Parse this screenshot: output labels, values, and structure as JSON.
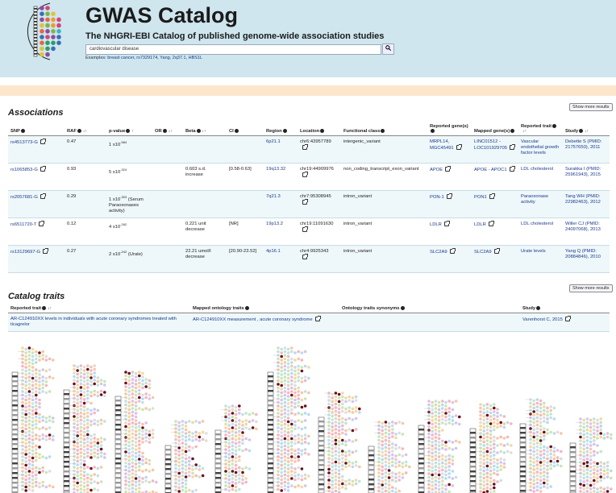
{
  "header": {
    "title": "GWAS Catalog",
    "subtitle": "The NHGRI-EBI Catalog of published genome-wide association studies",
    "search_value": "cardiovascular disease",
    "search_icon": "search-icon",
    "examples_label": "Examples:",
    "examples": [
      "breast cancer,",
      "rs7329174,",
      "Yang,",
      "2q37.1,",
      "HBS1L"
    ]
  },
  "associations": {
    "heading": "Associations",
    "show_more_top": "Show more results",
    "show_more_bottom": "Show more results",
    "columns": [
      "SNP",
      "RAF",
      "p-value",
      "OR",
      "Beta",
      "CI",
      "Region",
      "Location",
      "Functional class",
      "Reported gene(s)",
      "Mapped gene(s)",
      "Reported trait",
      "Study"
    ],
    "rows": [
      {
        "snp": "rs4513773-G",
        "raf": "0.47",
        "p_base": "1 x10",
        "p_exp": "-584",
        "p_note": "",
        "or": "",
        "beta": "",
        "ci": "",
        "region": "6p21.1",
        "location": "chr6:43957789",
        "func": "intergenic_variant",
        "reported": "MRPL14, MGC45491",
        "mapped": "LINC01512 - LOC101929705",
        "trait": "Vascular endothelial growth factor levels",
        "study": "Debette S (PMID: 21757650), 2011"
      },
      {
        "snp": "rs1065853-G",
        "raf": "0.93",
        "p_base": "5 x10",
        "p_exp": "-324",
        "p_note": "",
        "or": "",
        "beta": "0.603 s.d. increase",
        "ci": "[0.58-0.63]",
        "region": "19q13.32",
        "location": "chr19:44909976",
        "func": "non_coding_transcript_exon_variant",
        "reported": "APOE",
        "mapped": "APOE - APOC1",
        "trait": "LDL cholesterol",
        "study": "Surakka I (PMID: 25961943), 2015"
      },
      {
        "snp": "rs2057681-G",
        "raf": "0.29",
        "p_base": "1 x10",
        "p_exp": "-303",
        "p_note": "(Serum Paraoxonases activity)",
        "or": "",
        "beta": "",
        "ci": "",
        "region": "7q21.3",
        "location": "chr7:95308945",
        "func": "intron_variant",
        "reported": "PON-1",
        "mapped": "PON1",
        "trait": "Paraoxonase activity",
        "study": "Tang WH (PMID: 22982463), 2012"
      },
      {
        "snp": "rs6511720-T",
        "raf": "0.12",
        "p_base": "4 x10",
        "p_exp": "-262",
        "p_note": "",
        "or": "",
        "beta": "0.221 unit decrease",
        "ci": "[NR]",
        "region": "19p13.2",
        "location": "chr19:11091630",
        "func": "intron_variant",
        "reported": "LDLR",
        "mapped": "LDLR",
        "trait": "LDL cholesterol",
        "study": "Willer CJ (PMID: 24097068), 2013"
      },
      {
        "snp": "rs13129697-G",
        "raf": "0.27",
        "p_base": "2 x10",
        "p_exp": "-242",
        "p_note": "(Urate)",
        "or": "",
        "beta": "22.21 umol/l decrease",
        "ci": "[20.90-23.52]",
        "region": "4p16.1",
        "location": "chr4:9925343",
        "func": "intron_variant",
        "reported": "SLC2A9",
        "mapped": "SLC2A9",
        "trait": "Urate levels",
        "study": "Yang Q (PMID: 20884846), 2010"
      }
    ]
  },
  "catalog_traits": {
    "heading": "Catalog traits",
    "columns": [
      "Reported trait",
      "Mapped ontology traits",
      "Ontology traits synonyms",
      "Study"
    ],
    "rows": [
      {
        "reported": "AR-C124910XX levels in individuals with acute coronary syndromes treated with ticagrelor",
        "mapped": "AR-C124910XX measurement , acute coronary syndrome",
        "synonyms": "",
        "study": "Varenhorst C, 2015"
      }
    ]
  },
  "colors": {
    "header_bg": "#cfe6ee",
    "stripe": "#fde7cc",
    "link": "#1a3a8a",
    "hit": "#6b0f1a"
  }
}
